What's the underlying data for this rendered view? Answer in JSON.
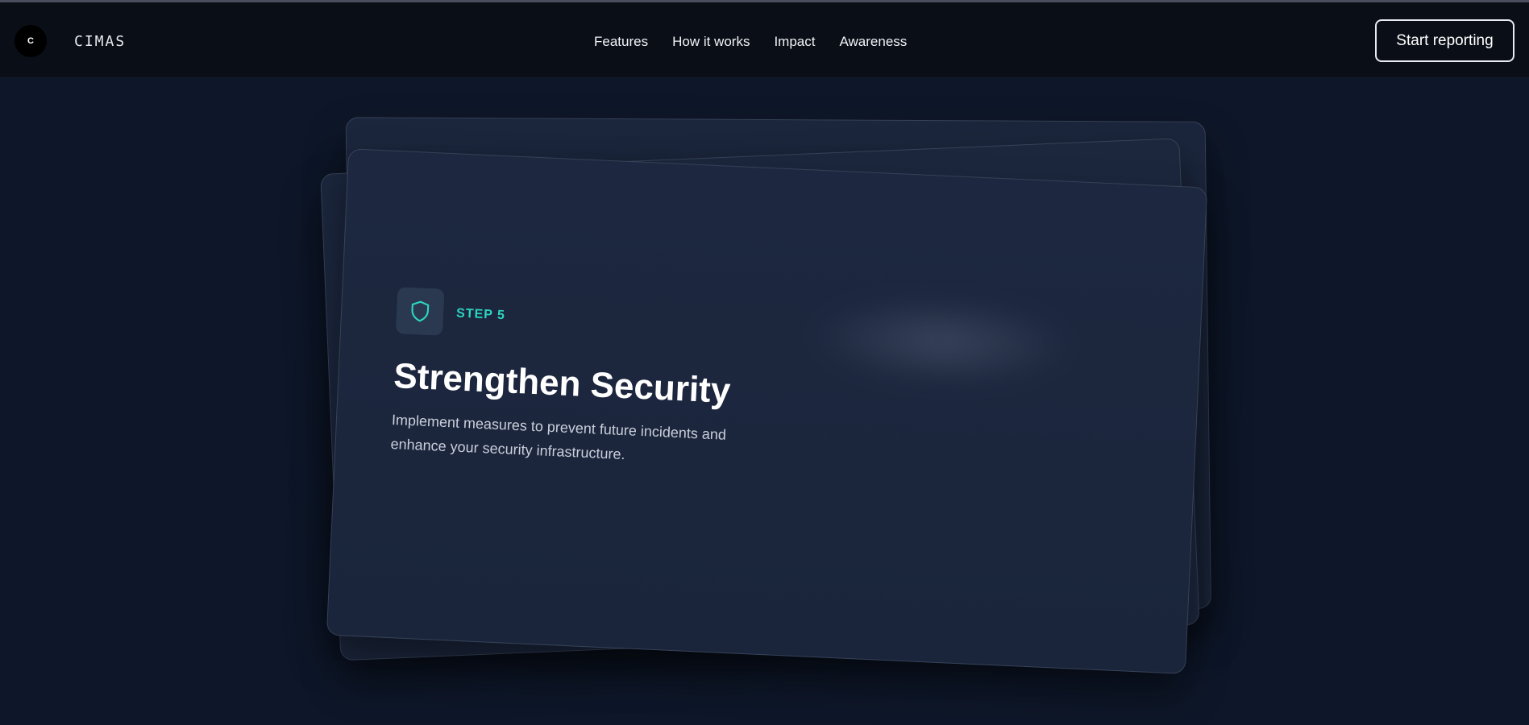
{
  "nav": {
    "logo_text": "C",
    "brand": "CIMAS",
    "links": [
      "Features",
      "How it works",
      "Impact",
      "Awareness"
    ],
    "cta": "Start reporting"
  },
  "card": {
    "icon": "shield-icon",
    "step": "STEP 5",
    "title": "Strengthen Security",
    "description": "Implement measures to prevent future incidents and enhance your security infrastructure."
  },
  "colors": {
    "accent": "#2dd4bf",
    "background": "#0e1729",
    "card": "#1d2840"
  }
}
